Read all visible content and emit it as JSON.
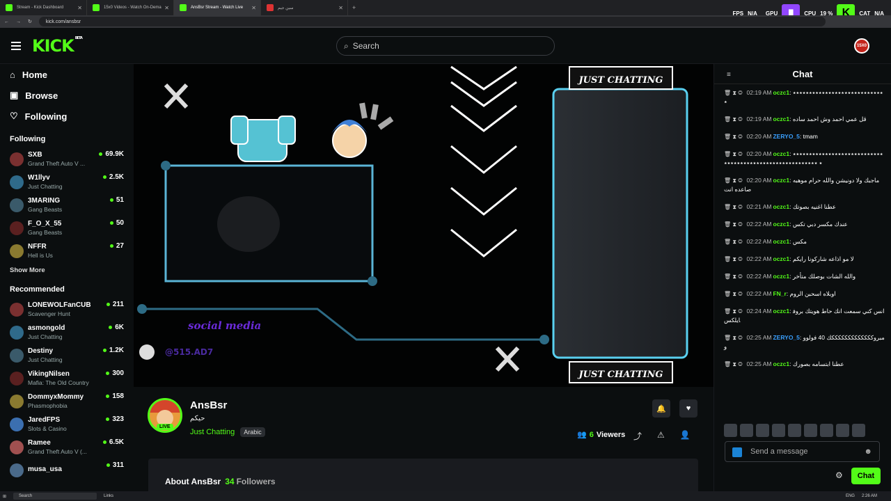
{
  "browser": {
    "tabs": [
      {
        "label": "Stream - Kick Dashboard",
        "active": false
      },
      {
        "label": "15x0 Videos - Watch On-Dema",
        "active": false
      },
      {
        "label": "AnsBsr Stream - Watch Live",
        "active": true
      },
      {
        "label": "سين جيم",
        "active": false
      }
    ],
    "url": "kick.com/ansbsr"
  },
  "overlay": {
    "fps_label": "FPS",
    "fps_value": "N/A",
    "gpu_label": "GPU",
    "cpu_label": "CPU",
    "cpu_value": "19 %",
    "cat_label": "CAT",
    "cat_value": "N/A"
  },
  "header": {
    "logo": "KICK",
    "logo_badge": "BETA",
    "search_placeholder": "Search",
    "user_avatar": "15X0"
  },
  "sidebar": {
    "nav": [
      {
        "label": "Home",
        "icon": "home-icon"
      },
      {
        "label": "Browse",
        "icon": "browse-icon"
      },
      {
        "label": "Following",
        "icon": "heart-icon"
      }
    ],
    "following_title": "Following",
    "following": [
      {
        "name": "SXB",
        "category": "Grand Theft Auto V ...",
        "viewers": "69.9K"
      },
      {
        "name": "W1llyv",
        "category": "Just Chatting",
        "viewers": "2.5K"
      },
      {
        "name": "3MARING",
        "category": "Gang Beasts",
        "viewers": "51"
      },
      {
        "name": "F_O_X_55",
        "category": "Gang Beasts",
        "viewers": "50"
      },
      {
        "name": "NFFR",
        "category": "Hell is Us",
        "viewers": "27"
      }
    ],
    "show_more": "Show More",
    "recommended_title": "Recommended",
    "recommended": [
      {
        "name": "LONEWOLFanCUB",
        "category": "Scavenger Hunt",
        "viewers": "211"
      },
      {
        "name": "asmongold",
        "category": "Just Chatting",
        "viewers": "6K"
      },
      {
        "name": "Destiny",
        "category": "Just Chatting",
        "viewers": "1.2K"
      },
      {
        "name": "VikingNilsen",
        "category": "Mafia: The Old Country",
        "viewers": "300"
      },
      {
        "name": "DommyxMommy",
        "category": "Phasmophobia",
        "viewers": "158"
      },
      {
        "name": "JaredFPS",
        "category": "Slots & Casino",
        "viewers": "323"
      },
      {
        "name": "Ramee",
        "category": "Grand Theft Auto V (...",
        "viewers": "6.5K"
      },
      {
        "name": "musa_usa",
        "category": "",
        "viewers": "311"
      }
    ]
  },
  "player": {
    "label_top": "JUST CHATTING",
    "label_bottom": "JUST CHATTING",
    "social": "social media",
    "handle": "@515.AD7"
  },
  "channel": {
    "name": "AnsBsr",
    "title": "حيكم",
    "category": "Just Chatting",
    "tag": "Arabic",
    "live": "LIVE",
    "viewers_count": "6",
    "viewers_label": "Viewers",
    "about_label": "About AnsBsr",
    "followers_count": "34",
    "followers_label": "Followers"
  },
  "chat": {
    "title": "Chat",
    "messages": [
      {
        "time": "02:19 AM",
        "user": "oczc1",
        "color": "#53fc18",
        "text": ": ٭٭٭٭٭٭٭٭٭٭٭٭٭٭٭٭٭٭٭٭٭٭٭٭٭٭٭٭٭"
      },
      {
        "time": "02:19 AM",
        "user": "oczc1",
        "color": "#53fc18",
        "text": ": قل عمي احمد وش احمد ساده"
      },
      {
        "time": "02:20 AM",
        "user": "ZERYO_5",
        "color": "#3aa0ff",
        "text": ": tmam"
      },
      {
        "time": "02:20 AM",
        "user": "oczc1",
        "color": "#53fc18",
        "text": ": ٭٭٭٭٭٭٭٭٭٭٭٭٭٭٭٭٭٭٭٭٭٭٭٭٭٭٭٭٭ ٭٭٭٭٭٭٭٭٭٭٭٭٭٭٭٭٭٭٭٭٭٭٭٭٭٭٭٭٭"
      },
      {
        "time": "02:20 AM",
        "user": "oczc1",
        "color": "#53fc18",
        "text": ": ماجبك ولا دونيشن والله حرام موهبه صاعده انت"
      },
      {
        "time": "02:21 AM",
        "user": "oczc1",
        "color": "#53fc18",
        "text": ": عطنا اغنيه بصوتك"
      },
      {
        "time": "02:22 AM",
        "user": "oczc1",
        "color": "#53fc18",
        "text": ": عندك مكسر دبي تكس"
      },
      {
        "time": "02:22 AM",
        "user": "oczc1",
        "color": "#53fc18",
        "text": ": مكس"
      },
      {
        "time": "02:22 AM",
        "user": "oczc1",
        "color": "#53fc18",
        "text": ": لا مو اذاعه شاركونا رايكم"
      },
      {
        "time": "02:22 AM",
        "user": "oczc1",
        "color": "#53fc18",
        "text": ": والله الشات بوصلك متأخر"
      },
      {
        "time": "02:22 AM",
        "user": "FN_r",
        "color": "#53fc18",
        "text": ": اوبلاه اسحبن الروم"
      },
      {
        "time": "02:24 AM",
        "user": "oczc1",
        "color": "#53fc18",
        "text": ": انس كني سمعت انك حاط هويتك بروفايلكس"
      },
      {
        "time": "02:25 AM",
        "user": "ZERYO_5",
        "color": "#3aa0ff",
        "text": ": مبروكككككككككككككك 40 فولووو"
      },
      {
        "time": "02:25 AM",
        "user": "oczc1",
        "color": "#53fc18",
        "text": ": عطنا ابتسامه بصورك"
      }
    ],
    "input_placeholder": "Send a message",
    "send_label": "Chat"
  },
  "taskbar": {
    "search": "Search",
    "links": "Links",
    "time": "2:26 AM",
    "lang": "ENG"
  }
}
